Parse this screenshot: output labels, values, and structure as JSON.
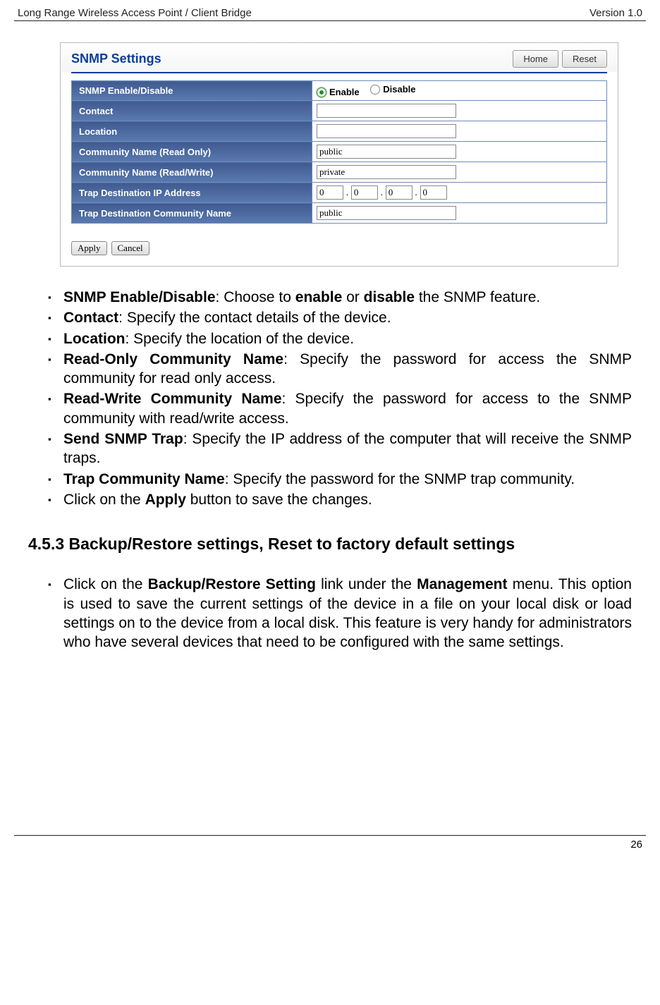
{
  "header": {
    "left": "Long Range Wireless Access Point / Client Bridge",
    "right": "Version 1.0"
  },
  "screenshot": {
    "title": "SNMP Settings",
    "homeBtn": "Home",
    "resetBtn": "Reset",
    "rows": {
      "enableLabel": "SNMP Enable/Disable",
      "enableOpt": "Enable",
      "disableOpt": "Disable",
      "contactLabel": "Contact",
      "contactVal": "",
      "locationLabel": "Location",
      "locationVal": "",
      "roLabel": "Community Name (Read Only)",
      "roVal": "public",
      "rwLabel": "Community Name (Read/Write)",
      "rwVal": "private",
      "trapIpLabel": "Trap Destination IP Address",
      "ip1": "0",
      "ip2": "0",
      "ip3": "0",
      "ip4": "0",
      "trapCommLabel": "Trap Destination Community Name",
      "trapCommVal": "public"
    },
    "applyBtn": "Apply",
    "cancelBtn": "Cancel"
  },
  "list1": {
    "i1a": "SNMP Enable/Disable",
    "i1b": ": Choose to ",
    "i1c": "enable",
    "i1d": " or ",
    "i1e": "disable",
    "i1f": " the SNMP feature.",
    "i2a": "Contact",
    "i2b": ": Specify the contact details of the device.",
    "i3a": "Location",
    "i3b": ": Specify the location of the device.",
    "i4a": "Read-Only Community Name",
    "i4b": ": Specify the password for access the SNMP community for read only access.",
    "i5a": "Read-Write Community Name",
    "i5b": ": Specify the password for access to the SNMP community with read/write access.",
    "i6a": "Send SNMP Trap",
    "i6b": ": Specify the IP address of the computer that will receive the SNMP traps.",
    "i7a": "Trap Community Name",
    "i7b": ": Specify the password for the SNMP trap community.",
    "i8a": "Click on the ",
    "i8b": "Apply",
    "i8c": " button to save the changes."
  },
  "section": "4.5.3 Backup/Restore settings, Reset to factory default settings",
  "list2": {
    "a": "Click on the ",
    "b": "Backup/Restore Setting",
    "c": " link under the ",
    "d": "Management",
    "e": " menu. This option is used to save the current settings of the device in a file on your local disk or load settings on to the device from a local disk. This feature is very handy for administrators who have several devices that need to be configured with the same settings."
  },
  "pageNum": "26"
}
